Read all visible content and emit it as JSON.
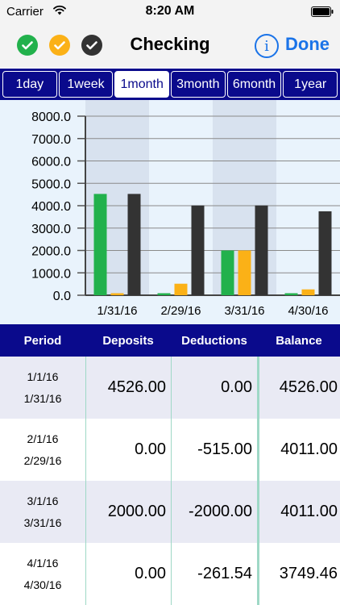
{
  "status_bar": {
    "carrier": "Carrier",
    "time": "8:20 AM"
  },
  "nav": {
    "title": "Checking",
    "info_label": "i",
    "done_label": "Done"
  },
  "tabs": [
    {
      "label": "1day",
      "selected": false
    },
    {
      "label": "1week",
      "selected": false
    },
    {
      "label": "1month",
      "selected": true
    },
    {
      "label": "3month",
      "selected": false
    },
    {
      "label": "6month",
      "selected": false
    },
    {
      "label": "1year",
      "selected": false
    }
  ],
  "colors": {
    "deposits": "#22b14c",
    "deductions": "#fbb117",
    "balance": "#333333",
    "header_blue": "#0a0a8c",
    "accent": "#1a73e8"
  },
  "table": {
    "headers": {
      "period": "Period",
      "deposits": "Deposits",
      "deductions": "Deductions",
      "balance": "Balance"
    },
    "rows": [
      {
        "start": "1/1/16",
        "end": "1/31/16",
        "deposits": "4526.00",
        "deductions": "0.00",
        "balance": "4526.00"
      },
      {
        "start": "2/1/16",
        "end": "2/29/16",
        "deposits": "0.00",
        "deductions": "-515.00",
        "balance": "4011.00"
      },
      {
        "start": "3/1/16",
        "end": "3/31/16",
        "deposits": "2000.00",
        "deductions": "-2000.00",
        "balance": "4011.00"
      },
      {
        "start": "4/1/16",
        "end": "4/30/16",
        "deposits": "0.00",
        "deductions": "-261.54",
        "balance": "3749.46"
      }
    ]
  },
  "chart_data": {
    "type": "bar",
    "categories": [
      "1/31/16",
      "2/29/16",
      "3/31/16",
      "4/30/16"
    ],
    "series": [
      {
        "values": [
          4526,
          0,
          2000,
          0
        ],
        "color": "#22b14c"
      },
      {
        "values": [
          0,
          515,
          2000,
          261.54
        ],
        "color": "#fbb117"
      },
      {
        "values": [
          4526,
          4011,
          4011,
          3749.46
        ],
        "color": "#333333"
      }
    ],
    "ylim": [
      0,
      8000
    ],
    "yticks": [
      "0.0",
      "1000.0",
      "2000.0",
      "3000.0",
      "4000.0",
      "5000.0",
      "6000.0",
      "7000.0",
      "8000.0"
    ],
    "grid": true
  }
}
